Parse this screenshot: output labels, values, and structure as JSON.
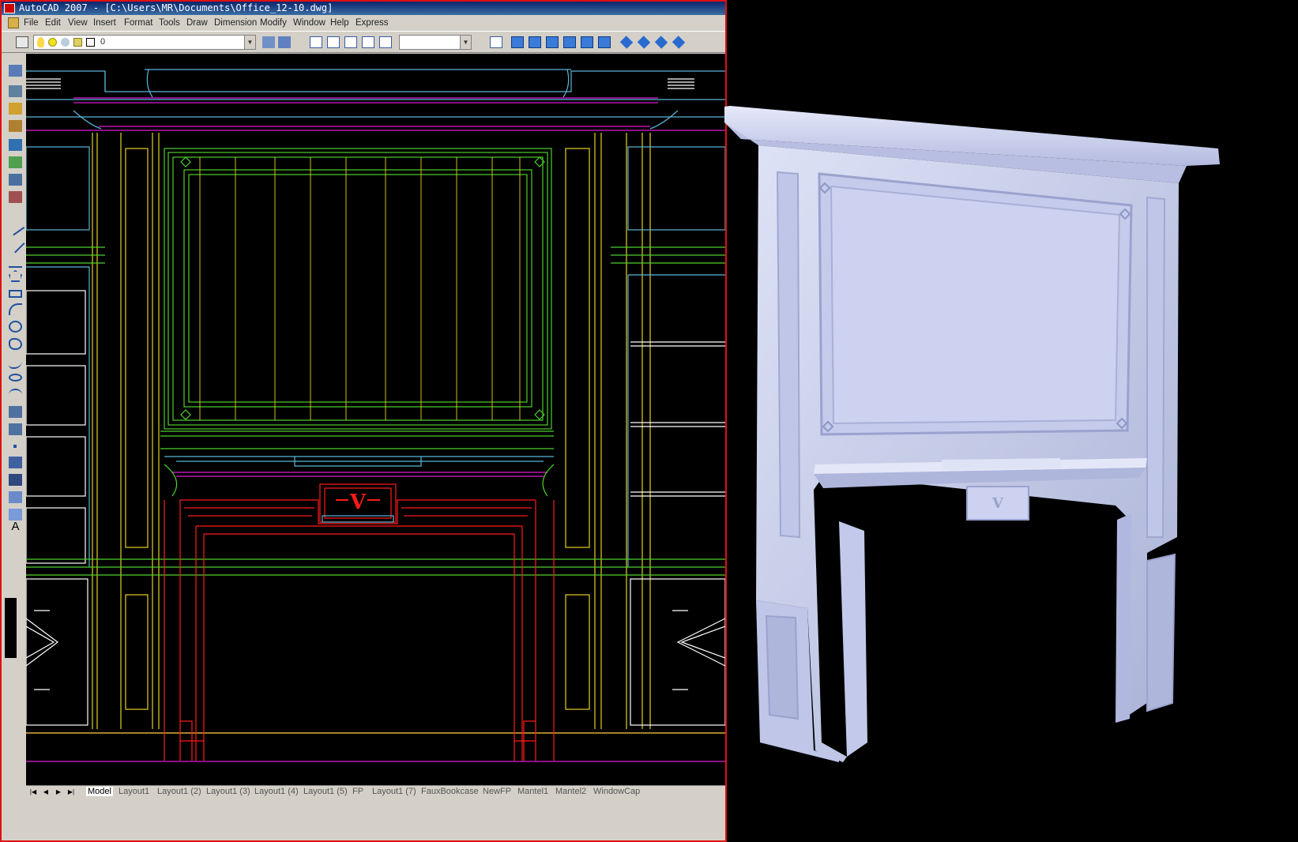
{
  "window": {
    "title": "AutoCAD 2007 - [C:\\Users\\MR\\Documents\\Office_12-10.dwg]"
  },
  "menu": [
    "File",
    "Edit",
    "View",
    "Insert",
    "Format",
    "Tools",
    "Draw",
    "Dimension",
    "Modify",
    "Window",
    "Help",
    "Express"
  ],
  "toolbar": {
    "layer_value": "0",
    "view_combo_value": ""
  },
  "layout_tabs": [
    "Model",
    "Layout1",
    "Layout1 (2)",
    "Layout1 (3)",
    "Layout1 (4)",
    "Layout1 (5)",
    "FP",
    "Layout1 (7)",
    "FauxBookcase",
    "NewFP",
    "Mantel1",
    "Mantel2",
    "WindowCap"
  ],
  "active_tab": "Model",
  "drawing": {
    "monogram": "V"
  },
  "render": {
    "monogram": "V"
  },
  "colors": {
    "red": "#ff1a1a",
    "green": "#4ccf2a",
    "magenta": "#e01ad8",
    "yellow": "#e6d020",
    "cyan": "#5ab6d8",
    "white": "#ffffff",
    "accent_border": "#e01010"
  }
}
